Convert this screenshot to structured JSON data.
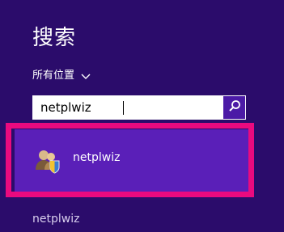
{
  "search_pane": {
    "title": "搜索",
    "scope": {
      "label": "所有位置"
    },
    "search": {
      "value": "netplwiz"
    },
    "results": [
      {
        "label": "netplwiz",
        "icon": "user-accounts-icon"
      }
    ],
    "suggestions": [
      {
        "label": "netplwiz"
      }
    ]
  },
  "colors": {
    "background": "#2b0c6b",
    "result_highlight": "#5a1fb8",
    "annotation_border": "#ea0a7f",
    "search_button": "#4b1aa6"
  }
}
